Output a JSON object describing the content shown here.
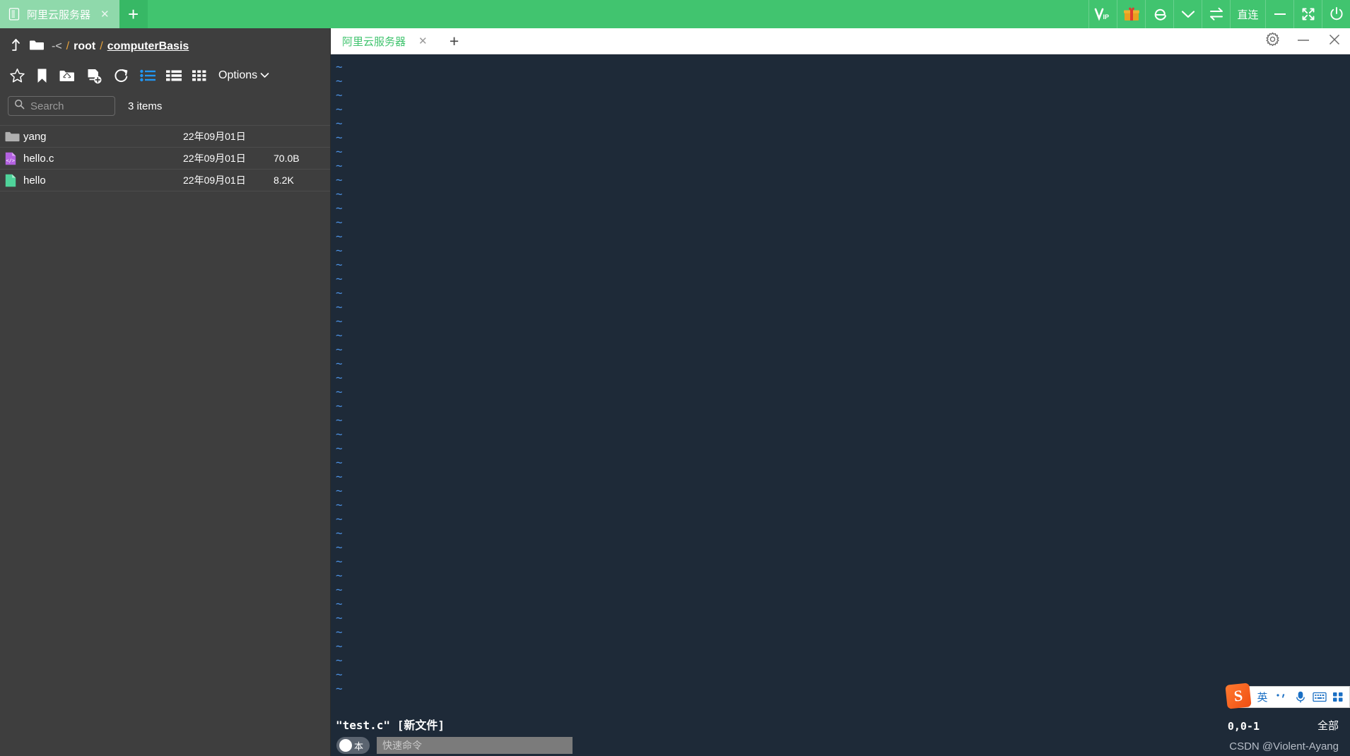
{
  "app_titlebar": {
    "tab": {
      "label": "阿里云服务器",
      "icon": "server-icon",
      "close_label": "✕"
    },
    "new_tab_label": "+",
    "actions": [
      {
        "name": "vip-button",
        "label": "VIP",
        "icon": "vip-icon"
      },
      {
        "name": "gift-button",
        "label": "",
        "icon": "gift-icon"
      },
      {
        "name": "browser-button",
        "label": "",
        "icon": "ie-browser-icon"
      },
      {
        "name": "dropdown-button",
        "label": "",
        "icon": "chevron-down-icon"
      },
      {
        "name": "transfer-button",
        "label": "",
        "icon": "transfer-icon"
      },
      {
        "name": "direct-connect-button",
        "label": "直连",
        "icon": ""
      },
      {
        "name": "minimize-button",
        "label": "",
        "icon": "minimize-icon"
      },
      {
        "name": "maximize-button",
        "label": "",
        "icon": "expand-icon"
      },
      {
        "name": "power-button",
        "label": "",
        "icon": "power-icon"
      }
    ]
  },
  "file_browser": {
    "breadcrumb": {
      "segments": [
        {
          "text": "-<",
          "kind": "muted"
        },
        {
          "text": "/",
          "kind": "sep"
        },
        {
          "text": "root",
          "kind": "plain"
        },
        {
          "text": "/",
          "kind": "sep"
        },
        {
          "text": "computerBasis",
          "kind": "current"
        }
      ]
    },
    "toolbar": {
      "icons": [
        {
          "name": "favorite-star-icon",
          "active": false
        },
        {
          "name": "bookmark-icon",
          "active": false
        },
        {
          "name": "upload-folder-icon",
          "active": false
        },
        {
          "name": "new-file-icon",
          "active": false
        },
        {
          "name": "refresh-icon",
          "active": false
        },
        {
          "name": "list-view-icon",
          "active": true
        },
        {
          "name": "detail-view-icon",
          "active": false
        },
        {
          "name": "grid-view-icon",
          "active": false
        }
      ],
      "options_label": "Options"
    },
    "search": {
      "placeholder": "Search",
      "value": "",
      "icon": "search-icon"
    },
    "item_count": "3 items",
    "files": [
      {
        "name": "yang",
        "date": "22年09月01日",
        "size": "",
        "icon": "folder-icon",
        "color": "#b0b0b0"
      },
      {
        "name": "hello.c",
        "date": "22年09月01日",
        "size": "70.0B",
        "icon": "code-file-icon",
        "color": "#b362e0"
      },
      {
        "name": "hello",
        "date": "22年09月01日",
        "size": "8.2K",
        "icon": "file-icon",
        "color": "#4fd39a"
      }
    ]
  },
  "terminal": {
    "tab": {
      "label": "阿里云服务器",
      "close_label": "✕"
    },
    "new_tab_label": "+",
    "window_buttons": [
      {
        "name": "settings-gear-button",
        "icon": "gear-icon"
      },
      {
        "name": "minimize-button",
        "icon": "minimize-icon"
      },
      {
        "name": "close-button",
        "icon": "close-icon"
      }
    ],
    "tilde_char": "~",
    "tilde_count": 45,
    "vim_status": "\"test.c\" [新文件]",
    "cursor_position": "0,0-1",
    "scroll_position": "全部",
    "watermark": "CSDN @Violent-Ayang",
    "quick_command": {
      "lang_toggle_label": "本",
      "placeholder": "快速命令",
      "value": ""
    }
  },
  "sogou_ime": {
    "logo_text": "S",
    "items": [
      {
        "name": "ime-mode-english",
        "label": "英"
      },
      {
        "name": "ime-punctuation-toggle",
        "label": "·,"
      },
      {
        "name": "ime-voice-input",
        "label": "mic"
      },
      {
        "name": "ime-soft-keyboard",
        "label": "kbd"
      },
      {
        "name": "ime-toolbox",
        "label": "grid"
      }
    ]
  },
  "colors": {
    "brand_green": "#41c46f",
    "terminal_bg": "#1e2a38",
    "tilde_blue": "#4b8fe0",
    "accent_blue": "#2196f3",
    "panel_bg": "#3e3e3e"
  }
}
